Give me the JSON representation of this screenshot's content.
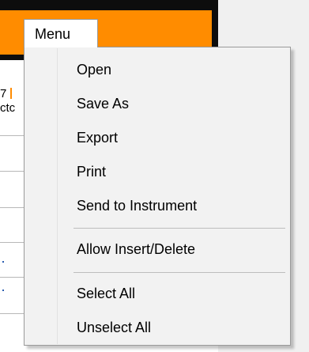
{
  "menu": {
    "title": "Menu",
    "items": [
      {
        "label": "Open"
      },
      {
        "label": "Save As"
      },
      {
        "label": "Export"
      },
      {
        "label": "Print"
      },
      {
        "label": "Send to Instrument"
      },
      {
        "label": "Allow Insert/Delete"
      },
      {
        "label": "Select All"
      },
      {
        "label": "Unselect All"
      }
    ]
  },
  "background": {
    "row_1_text": "7",
    "row_2_text": "ctc"
  },
  "colors": {
    "accent_orange": "#ff8c00",
    "header_black": "#0d0d0d",
    "menu_background": "#f2f2f2",
    "menu_border": "#9a9a9a",
    "link_blue": "#2a5db0"
  }
}
